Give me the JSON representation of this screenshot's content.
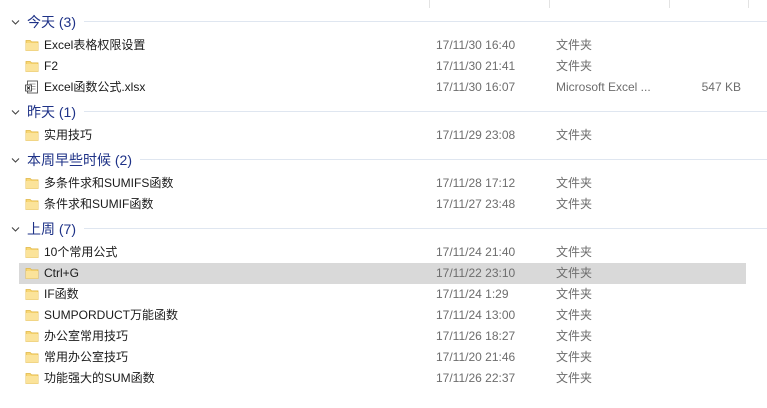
{
  "columns_header": {
    "visible": true
  },
  "groups": [
    {
      "title": "今天 (3)",
      "items": [
        {
          "name": "Excel表格权限设置",
          "date": "17/11/30 16:40",
          "type": "文件夹",
          "size": "",
          "icon": "folder-icon"
        },
        {
          "name": "F2",
          "date": "17/11/30 21:41",
          "type": "文件夹",
          "size": "",
          "icon": "folder-icon"
        },
        {
          "name": "Excel函数公式.xlsx",
          "date": "17/11/30 16:07",
          "type": "Microsoft Excel ...",
          "size": "547 KB",
          "icon": "excel-file-icon"
        }
      ]
    },
    {
      "title": "昨天 (1)",
      "items": [
        {
          "name": "实用技巧",
          "date": "17/11/29 23:08",
          "type": "文件夹",
          "size": "",
          "icon": "folder-icon"
        }
      ]
    },
    {
      "title": "本周早些时候 (2)",
      "items": [
        {
          "name": "多条件求和SUMIFS函数",
          "date": "17/11/28 17:12",
          "type": "文件夹",
          "size": "",
          "icon": "folder-icon"
        },
        {
          "name": "条件求和SUMIF函数",
          "date": "17/11/27 23:48",
          "type": "文件夹",
          "size": "",
          "icon": "folder-icon"
        }
      ]
    },
    {
      "title": "上周 (7)",
      "items": [
        {
          "name": "10个常用公式",
          "date": "17/11/24 21:40",
          "type": "文件夹",
          "size": "",
          "icon": "folder-icon"
        },
        {
          "name": "Ctrl+G",
          "date": "17/11/22 23:10",
          "type": "文件夹",
          "size": "",
          "icon": "folder-icon",
          "selected": true
        },
        {
          "name": "IF函数",
          "date": "17/11/24 1:29",
          "type": "文件夹",
          "size": "",
          "icon": "folder-icon"
        },
        {
          "name": "SUMPORDUCT万能函数",
          "date": "17/11/24 13:00",
          "type": "文件夹",
          "size": "",
          "icon": "folder-icon"
        },
        {
          "name": "办公室常用技巧",
          "date": "17/11/26 18:27",
          "type": "文件夹",
          "size": "",
          "icon": "folder-icon"
        },
        {
          "name": "常用办公室技巧",
          "date": "17/11/20 21:46",
          "type": "文件夹",
          "size": "",
          "icon": "folder-icon"
        },
        {
          "name": "功能强大的SUM函数",
          "date": "17/11/26 22:37",
          "type": "文件夹",
          "size": "",
          "icon": "folder-icon"
        }
      ]
    }
  ],
  "colors": {
    "group_title": "#1e3287",
    "selected_row": "#d9d9d9",
    "folder": "#f8d775"
  }
}
